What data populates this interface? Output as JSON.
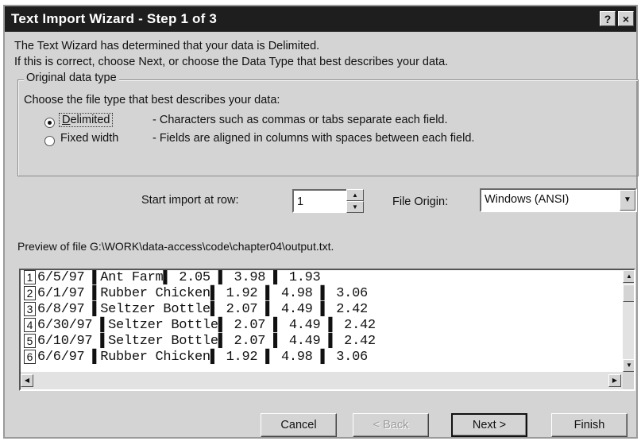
{
  "window": {
    "title": "Text Import Wizard - Step 1 of 3",
    "help_button": "?",
    "close_button": "×"
  },
  "intro": {
    "line1": "The Text Wizard has determined that your data is Delimited.",
    "line2": "If this is correct, choose Next, or choose the Data Type that best describes your data."
  },
  "data_type": {
    "group_label": "Original data type",
    "prompt": "Choose the file type that best describes your data:",
    "options": [
      {
        "label": "Delimited",
        "description": "- Characters such as commas or tabs separate each field.",
        "selected": true
      },
      {
        "label": "Fixed width",
        "description": "- Fields are aligned in columns with spaces between each field.",
        "selected": false
      }
    ]
  },
  "start_row": {
    "label": "Start import at row:",
    "value": "1"
  },
  "file_origin": {
    "label": "File Origin:",
    "value": "Windows (ANSI)"
  },
  "preview": {
    "label": "Preview of file G:\\WORK\\data-access\\code\\chapter04\\output.txt.",
    "rows": [
      {
        "num": "1",
        "text": "6/5/97 ▌Ant Farm▌ 2.05 ▌ 3.98 ▌ 1.93"
      },
      {
        "num": "2",
        "text": "6/1/97 ▌Rubber Chicken▌ 1.92 ▌ 4.98 ▌ 3.06"
      },
      {
        "num": "3",
        "text": "6/8/97 ▌Seltzer Bottle▌ 2.07 ▌ 4.49 ▌ 2.42"
      },
      {
        "num": "4",
        "text": "6/30/97 ▌Seltzer Bottle▌ 2.07 ▌ 4.49 ▌ 2.42"
      },
      {
        "num": "5",
        "text": "6/10/97 ▌Seltzer Bottle▌ 2.07 ▌ 4.49 ▌ 2.42"
      },
      {
        "num": "6",
        "text": "6/6/97 ▌Rubber Chicken▌ 1.92 ▌ 4.98 ▌ 3.06"
      }
    ]
  },
  "buttons": {
    "cancel": "Cancel",
    "back": "< Back",
    "next": "Next >",
    "finish": "Finish"
  },
  "colors": {
    "titlebar": "#1e1e1e",
    "dialog": "#d4d4d4",
    "field": "#ffffff"
  },
  "icons": {
    "spin_up": "up-arrow-icon",
    "spin_down": "down-arrow-icon",
    "dropdown": "chevron-down-icon"
  }
}
